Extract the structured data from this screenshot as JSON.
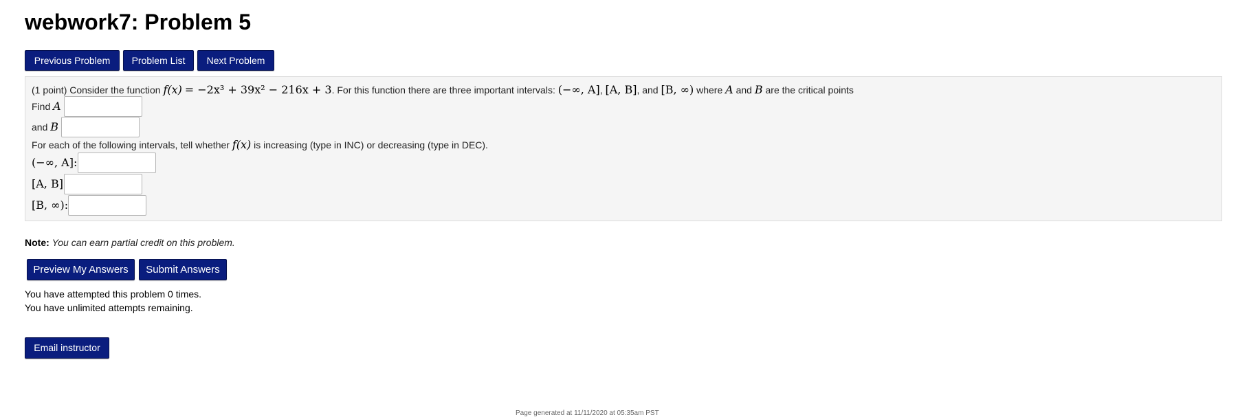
{
  "page_title": "webwork7: Problem 5",
  "nav": {
    "previous_label": "Previous Problem",
    "list_label": "Problem List",
    "next_label": "Next Problem"
  },
  "problem": {
    "intro_points": "(1 point) Consider the function",
    "function_lhs": "f(x)",
    "function_rhs": "= −2x³ + 39x² − 216x + 3",
    "intro_mid": ". For this function there are three important intervals:",
    "interval_1": "(−∞, A]",
    "interval_2": "[A, B]",
    "intro_and": ", and",
    "interval_3": "[B, ∞)",
    "intro_where": "where",
    "var_a": "A",
    "intro_and2": "and",
    "var_b": "B",
    "intro_end": "are the critical points",
    "find_a_label": "Find",
    "and_b_label": "and",
    "instruction_pre": "For each of the following intervals, tell whether",
    "instruction_post": "is increasing (type in INC) or decreasing (type in DEC).",
    "interval_label_1": "(−∞, A]:",
    "interval_label_2": "[A, B]:",
    "interval_label_3": "[B, ∞):",
    "answers": {
      "a": "",
      "b": "",
      "int1": "",
      "int2": "",
      "int3": ""
    }
  },
  "note": {
    "label": "Note:",
    "text": "You can earn partial credit on this problem."
  },
  "actions": {
    "preview_label": "Preview My Answers",
    "submit_label": "Submit Answers"
  },
  "status": {
    "attempts": "You have attempted this problem 0 times.",
    "remaining": "You have unlimited attempts remaining."
  },
  "email_label": "Email instructor",
  "footer": "Page generated at 11/11/2020 at 05:35am PST",
  "colors": {
    "button_bg": "#0a1d7e",
    "problem_bg": "#f5f5f5"
  }
}
